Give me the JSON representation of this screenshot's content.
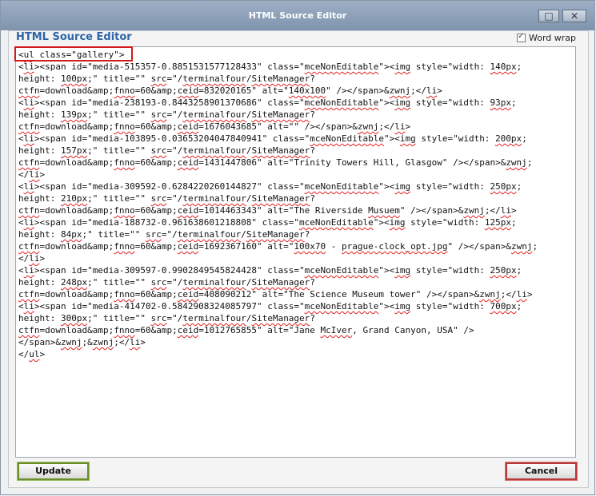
{
  "window": {
    "title": "HTML Source Editor"
  },
  "dialog": {
    "heading": "HTML Source Editor",
    "word_wrap_label": "Word wrap",
    "word_wrap_checked": true,
    "update_label": "Update",
    "cancel_label": "Cancel"
  },
  "source_lines": [
    [
      [
        "<",
        0
      ],
      [
        "ul",
        1
      ],
      [
        " class=\"gallery\">",
        0
      ]
    ],
    [
      [
        "<",
        0
      ],
      [
        "li",
        1
      ],
      [
        "><span id=\"media-515357-0.8851531577128433\" class=\"",
        0
      ],
      [
        "mceNonEditable",
        1
      ],
      [
        "\"><",
        0
      ],
      [
        "img",
        1
      ],
      [
        " style=\"width: ",
        0
      ],
      [
        "140px",
        1
      ],
      [
        ";",
        0
      ]
    ],
    [
      [
        "height: ",
        0
      ],
      [
        "100px",
        1
      ],
      [
        ";\" title=\"\" ",
        0
      ],
      [
        "src",
        1
      ],
      [
        "=\"/",
        0
      ],
      [
        "terminalfour",
        1
      ],
      [
        "/",
        0
      ],
      [
        "SiteManager",
        1
      ],
      [
        "?",
        0
      ]
    ],
    [
      [
        "ctfn",
        1
      ],
      [
        "=download&amp;",
        0
      ],
      [
        "fnno",
        1
      ],
      [
        "=60&amp;",
        0
      ],
      [
        "ceid",
        1
      ],
      [
        "=832020165\" alt=\"",
        0
      ],
      [
        "140x100",
        1
      ],
      [
        "\" /></span>&",
        0
      ],
      [
        "zwnj",
        1
      ],
      [
        ";</",
        0
      ],
      [
        "li",
        1
      ],
      [
        ">",
        0
      ]
    ],
    [
      [
        "<",
        0
      ],
      [
        "li",
        1
      ],
      [
        "><span id=\"media-238193-0.8443258901370686\" class=\"",
        0
      ],
      [
        "mceNonEditable",
        1
      ],
      [
        "\"><",
        0
      ],
      [
        "img",
        1
      ],
      [
        " style=\"width: ",
        0
      ],
      [
        "93px",
        1
      ],
      [
        ";",
        0
      ]
    ],
    [
      [
        "height: ",
        0
      ],
      [
        "139px",
        1
      ],
      [
        ";\" title=\"\" ",
        0
      ],
      [
        "src",
        1
      ],
      [
        "=\"/",
        0
      ],
      [
        "terminalfour",
        1
      ],
      [
        "/",
        0
      ],
      [
        "SiteManager",
        1
      ],
      [
        "?",
        0
      ]
    ],
    [
      [
        "ctfn",
        1
      ],
      [
        "=download&amp;",
        0
      ],
      [
        "fnno",
        1
      ],
      [
        "=60&amp;",
        0
      ],
      [
        "ceid",
        1
      ],
      [
        "=1676043685\" alt=\"\" /></span>&",
        0
      ],
      [
        "zwnj",
        1
      ],
      [
        ";</",
        0
      ],
      [
        "li",
        1
      ],
      [
        ">",
        0
      ]
    ],
    [
      [
        "<",
        0
      ],
      [
        "li",
        1
      ],
      [
        "><span id=\"media-103895-0.03653204047840941\" class=\"",
        0
      ],
      [
        "mceNonEditable",
        1
      ],
      [
        "\"><",
        0
      ],
      [
        "img",
        1
      ],
      [
        " style=\"width: ",
        0
      ],
      [
        "200px",
        1
      ],
      [
        ";",
        0
      ]
    ],
    [
      [
        "height: ",
        0
      ],
      [
        "157px",
        1
      ],
      [
        ";\" title=\"\" ",
        0
      ],
      [
        "src",
        1
      ],
      [
        "=\"/",
        0
      ],
      [
        "terminalfour",
        1
      ],
      [
        "/",
        0
      ],
      [
        "SiteManager",
        1
      ],
      [
        "?",
        0
      ]
    ],
    [
      [
        "ctfn",
        1
      ],
      [
        "=download&amp;",
        0
      ],
      [
        "fnno",
        1
      ],
      [
        "=60&amp;",
        0
      ],
      [
        "ceid",
        1
      ],
      [
        "=1431447806\" alt=\"Trinity Towers Hill, Glasgow\" /></span>&",
        0
      ],
      [
        "zwnj",
        1
      ],
      [
        ";",
        0
      ]
    ],
    [
      [
        "</",
        0
      ],
      [
        "li",
        1
      ],
      [
        ">",
        0
      ]
    ],
    [
      [
        "<",
        0
      ],
      [
        "li",
        1
      ],
      [
        "><span id=\"media-309592-0.6284220260144827\" class=\"",
        0
      ],
      [
        "mceNonEditable",
        1
      ],
      [
        "\"><",
        0
      ],
      [
        "img",
        1
      ],
      [
        " style=\"width: ",
        0
      ],
      [
        "250px",
        1
      ],
      [
        ";",
        0
      ]
    ],
    [
      [
        "height: ",
        0
      ],
      [
        "210px",
        1
      ],
      [
        ";\" title=\"\" ",
        0
      ],
      [
        "src",
        1
      ],
      [
        "=\"/",
        0
      ],
      [
        "terminalfour",
        1
      ],
      [
        "/",
        0
      ],
      [
        "SiteManager",
        1
      ],
      [
        "?",
        0
      ]
    ],
    [
      [
        "ctfn",
        1
      ],
      [
        "=download&amp;",
        0
      ],
      [
        "fnno",
        1
      ],
      [
        "=60&amp;",
        0
      ],
      [
        "ceid",
        1
      ],
      [
        "=1014463343\" alt=\"The Riverside ",
        0
      ],
      [
        "Musuem",
        1
      ],
      [
        "\" /></span>&",
        0
      ],
      [
        "zwnj",
        1
      ],
      [
        ";</",
        0
      ],
      [
        "li",
        1
      ],
      [
        ">",
        0
      ]
    ],
    [
      [
        "<",
        0
      ],
      [
        "li",
        1
      ],
      [
        "><span id=\"media-188732-0.961638601218808\" class=\"",
        0
      ],
      [
        "mceNonEditable",
        1
      ],
      [
        "\"><",
        0
      ],
      [
        "img",
        1
      ],
      [
        " style=\"width: ",
        0
      ],
      [
        "125px",
        1
      ],
      [
        ";",
        0
      ]
    ],
    [
      [
        "height: ",
        0
      ],
      [
        "84px",
        1
      ],
      [
        ";\" title=\"\" ",
        0
      ],
      [
        "src",
        1
      ],
      [
        "=\"/",
        0
      ],
      [
        "terminalfour",
        1
      ],
      [
        "/",
        0
      ],
      [
        "SiteManager",
        1
      ],
      [
        "?",
        0
      ]
    ],
    [
      [
        "ctfn",
        1
      ],
      [
        "=download&amp;",
        0
      ],
      [
        "fnno",
        1
      ],
      [
        "=60&amp;",
        0
      ],
      [
        "ceid",
        1
      ],
      [
        "=1692367160\" alt=\"",
        0
      ],
      [
        "100x70",
        1
      ],
      [
        " - ",
        0
      ],
      [
        "prague-clock_opt.jpg",
        1
      ],
      [
        "\" /></span>&",
        0
      ],
      [
        "zwnj",
        1
      ],
      [
        ";",
        0
      ]
    ],
    [
      [
        "</",
        0
      ],
      [
        "li",
        1
      ],
      [
        ">",
        0
      ]
    ],
    [
      [
        "<",
        0
      ],
      [
        "li",
        1
      ],
      [
        "><span id=\"media-309597-0.9902849545824428\" class=\"",
        0
      ],
      [
        "mceNonEditable",
        1
      ],
      [
        "\"><",
        0
      ],
      [
        "img",
        1
      ],
      [
        " style=\"width: ",
        0
      ],
      [
        "250px",
        1
      ],
      [
        ";",
        0
      ]
    ],
    [
      [
        "height: ",
        0
      ],
      [
        "248px",
        1
      ],
      [
        ";\" title=\"\" ",
        0
      ],
      [
        "src",
        1
      ],
      [
        "=\"/",
        0
      ],
      [
        "terminalfour",
        1
      ],
      [
        "/",
        0
      ],
      [
        "SiteManager",
        1
      ],
      [
        "?",
        0
      ]
    ],
    [
      [
        "ctfn",
        1
      ],
      [
        "=download&amp;",
        0
      ],
      [
        "fnno",
        1
      ],
      [
        "=60&amp;",
        0
      ],
      [
        "ceid",
        1
      ],
      [
        "=408090212\" alt=\"The Science Museum tower\" /></span>&",
        0
      ],
      [
        "zwnj",
        1
      ],
      [
        ";</",
        0
      ],
      [
        "li",
        1
      ],
      [
        ">",
        0
      ]
    ],
    [
      [
        "<",
        0
      ],
      [
        "li",
        1
      ],
      [
        "><span id=\"media-414702-0.5842908324085797\" class=\"",
        0
      ],
      [
        "mceNonEditable",
        1
      ],
      [
        "\"><",
        0
      ],
      [
        "img",
        1
      ],
      [
        " style=\"width: ",
        0
      ],
      [
        "700px",
        1
      ],
      [
        ";",
        0
      ]
    ],
    [
      [
        "height: ",
        0
      ],
      [
        "300px",
        1
      ],
      [
        ";\" title=\"\" ",
        0
      ],
      [
        "src",
        1
      ],
      [
        "=\"/",
        0
      ],
      [
        "terminalfour",
        1
      ],
      [
        "/",
        0
      ],
      [
        "SiteManager",
        1
      ],
      [
        "?",
        0
      ]
    ],
    [
      [
        "ctfn",
        1
      ],
      [
        "=download&amp;",
        0
      ],
      [
        "fnno",
        1
      ],
      [
        "=60&amp;",
        0
      ],
      [
        "ceid",
        1
      ],
      [
        "=1012765855\" alt=\"Jane ",
        0
      ],
      [
        "McIver",
        1
      ],
      [
        ", Grand Canyon, USA\" />",
        0
      ]
    ],
    [
      [
        "</span>&",
        0
      ],
      [
        "zwnj",
        1
      ],
      [
        ";&",
        0
      ],
      [
        "zwnj",
        1
      ],
      [
        ";</",
        0
      ],
      [
        "li",
        1
      ],
      [
        ">",
        0
      ]
    ],
    [
      [
        "</",
        0
      ],
      [
        "ul",
        1
      ],
      [
        ">",
        0
      ]
    ]
  ]
}
